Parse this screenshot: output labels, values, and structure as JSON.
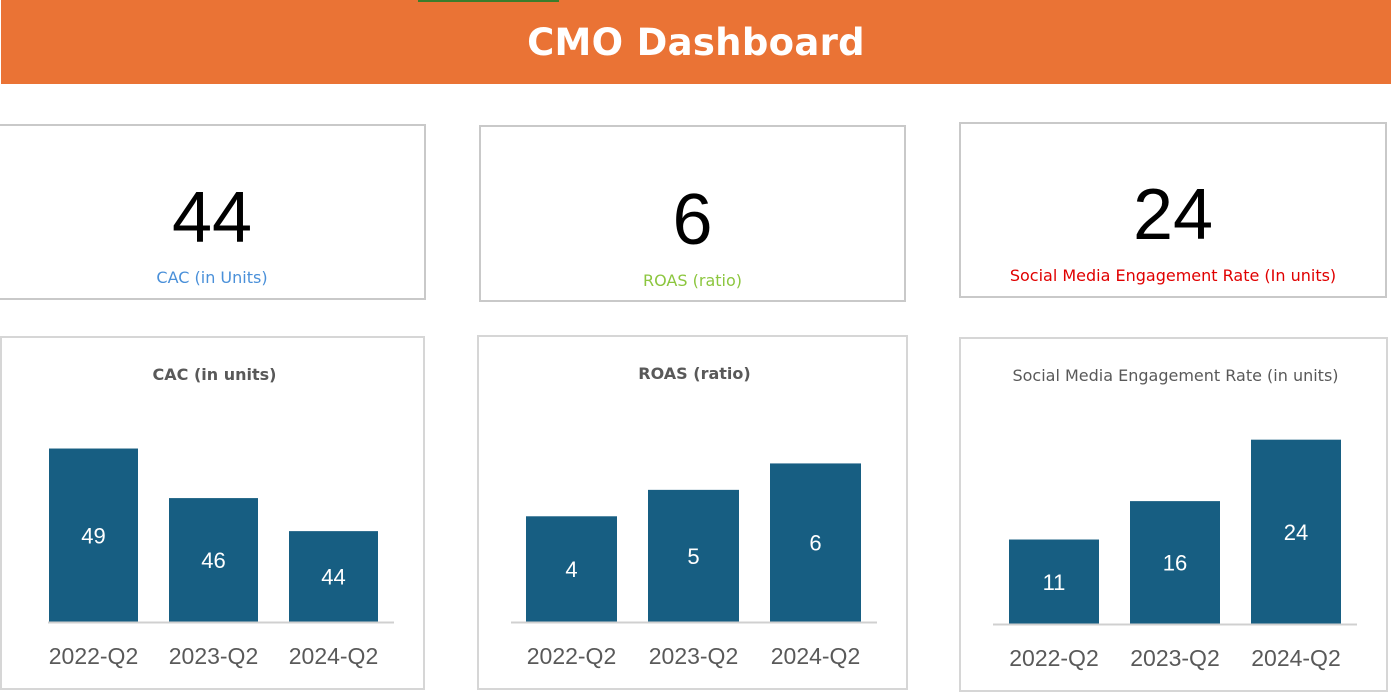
{
  "header": {
    "title": "CMO Dashboard",
    "background": "#EA7335"
  },
  "kpis": [
    {
      "value": "44",
      "label": "CAC (in Units)",
      "label_color": "#4A90D9"
    },
    {
      "value": "6",
      "label": "ROAS (ratio)",
      "label_color": "#8CC63F"
    },
    {
      "value": "24",
      "label": "Social Media Engagement Rate (In units)",
      "label_color": "#E00000"
    }
  ],
  "chart_data": [
    {
      "type": "bar",
      "title": "CAC (in units)",
      "categories": [
        "2022-Q2",
        "2023-Q2",
        "2024-Q2"
      ],
      "values": [
        49,
        46,
        44
      ],
      "ylim": [
        38.5,
        50
      ],
      "grid": false,
      "bar_color": "#175E82",
      "data_labels": true
    },
    {
      "type": "bar",
      "title": "ROAS (ratio)",
      "categories": [
        "2022-Q2",
        "2023-Q2",
        "2024-Q2"
      ],
      "values": [
        4,
        5,
        6
      ],
      "ylim": [
        0,
        7
      ],
      "grid": false,
      "bar_color": "#175E82",
      "data_labels": true
    },
    {
      "type": "bar",
      "title": "Social Media Engagement Rate (in units)",
      "categories": [
        "2022-Q2",
        "2023-Q2",
        "2024-Q2"
      ],
      "values": [
        11,
        16,
        24
      ],
      "ylim": [
        0,
        25
      ],
      "grid": false,
      "bar_color": "#175E82",
      "data_labels": true
    }
  ]
}
